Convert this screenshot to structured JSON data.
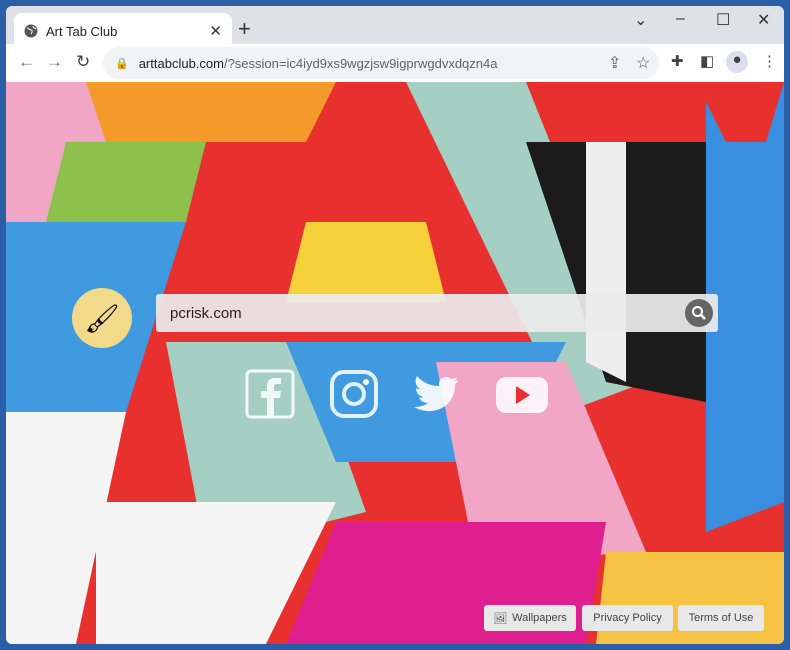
{
  "tab": {
    "title": "Art Tab Club",
    "icon": "globe-icon"
  },
  "address": {
    "domain": "arttabclub.com",
    "path": "/?session=ic4iyd9xs9wgzjsw9igprwgdvxdqzn4a"
  },
  "search": {
    "value": "pcrisk.com"
  },
  "social": [
    "facebook",
    "instagram",
    "twitter",
    "youtube"
  ],
  "footer": {
    "wallpapers": "Wallpapers",
    "privacy": "Privacy Policy",
    "terms": "Terms of Use"
  },
  "colors": {
    "frame": "#2a5ea6",
    "accent": "#e8312f"
  }
}
